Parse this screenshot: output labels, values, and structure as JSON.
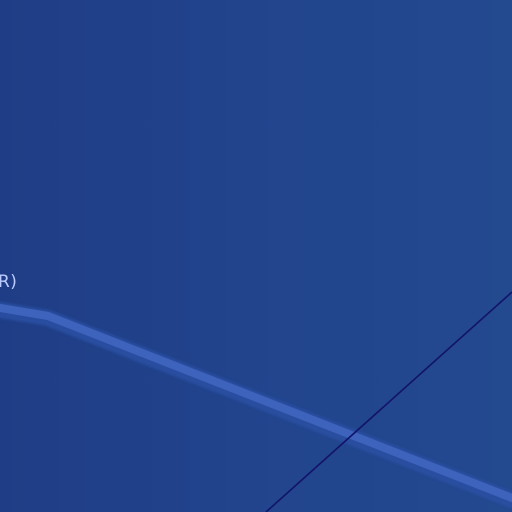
{
  "desktop": {
    "visible_text": "R)",
    "colors": {
      "background_start": "#1f3d86",
      "background_end": "#23498f",
      "highlight_band": "#3d62bb",
      "thin_line": "#12136a",
      "text": "#bccbff"
    }
  }
}
